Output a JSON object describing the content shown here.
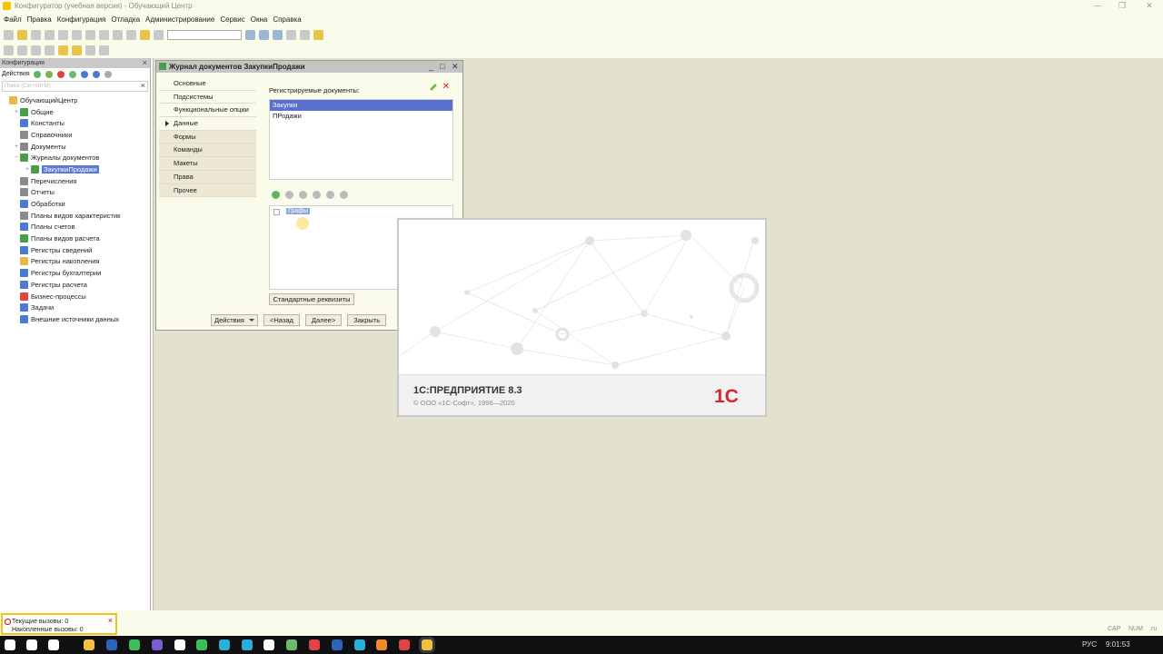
{
  "window": {
    "title": "Конфигуратор (учебная версия) - Обучающий Центр",
    "controls": [
      "—",
      "❐",
      "✕"
    ]
  },
  "menu": [
    "Файл",
    "Правка",
    "Конфигурация",
    "Отладка",
    "Администрирование",
    "Сервис",
    "Окна",
    "Справка"
  ],
  "config_panel": {
    "title": "Конфигурация",
    "actions_label": "Действия",
    "search_placeholder": "Поиск (Ctrl+Alt+M)",
    "tree": [
      {
        "label": "ОбучающийЦентр",
        "level": 0,
        "expander": "",
        "icon_color": "#e7b84a"
      },
      {
        "label": "Общие",
        "level": 1,
        "expander": "+",
        "icon_color": "#4c9c4c"
      },
      {
        "label": "Константы",
        "level": 1,
        "expander": "",
        "icon_color": "#4a7bd0"
      },
      {
        "label": "Справочники",
        "level": 1,
        "expander": "",
        "icon_color": "#8a8a8a"
      },
      {
        "label": "Документы",
        "level": 1,
        "expander": "+",
        "icon_color": "#8a8a8a"
      },
      {
        "label": "Журналы документов",
        "level": 1,
        "expander": "−",
        "icon_color": "#4c9c4c"
      },
      {
        "label": "ЗакупкиПродажи",
        "level": 2,
        "expander": "+",
        "icon_color": "#4c9c4c",
        "selected": true
      },
      {
        "label": "Перечисления",
        "level": 1,
        "expander": "",
        "icon_color": "#8a8a8a"
      },
      {
        "label": "Отчеты",
        "level": 1,
        "expander": "",
        "icon_color": "#8a8a8a"
      },
      {
        "label": "Обработки",
        "level": 1,
        "expander": "",
        "icon_color": "#4a7bd0"
      },
      {
        "label": "Планы видов характеристик",
        "level": 1,
        "expander": "",
        "icon_color": "#8a8a8a"
      },
      {
        "label": "Планы счетов",
        "level": 1,
        "expander": "",
        "icon_color": "#4a7bd0"
      },
      {
        "label": "Планы видов расчета",
        "level": 1,
        "expander": "",
        "icon_color": "#4c9c4c"
      },
      {
        "label": "Регистры сведений",
        "level": 1,
        "expander": "",
        "icon_color": "#4a7bd0"
      },
      {
        "label": "Регистры накопления",
        "level": 1,
        "expander": "",
        "icon_color": "#e7b84a"
      },
      {
        "label": "Регистры бухгалтерии",
        "level": 1,
        "expander": "",
        "icon_color": "#4a7bd0"
      },
      {
        "label": "Регистры расчета",
        "level": 1,
        "expander": "",
        "icon_color": "#4a7bd0"
      },
      {
        "label": "Бизнес-процессы",
        "level": 1,
        "expander": "",
        "icon_color": "#d44"
      },
      {
        "label": "Задачи",
        "level": 1,
        "expander": "",
        "icon_color": "#4a7bd0"
      },
      {
        "label": "Внешние источники данных",
        "level": 1,
        "expander": "",
        "icon_color": "#4a7bd0"
      }
    ]
  },
  "doc_window": {
    "title": "Журнал документов ЗакупкиПродажи",
    "tabs": [
      {
        "label": "Основные",
        "style": "light"
      },
      {
        "label": "Подсистемы",
        "style": "light"
      },
      {
        "label": "Функциональные опции",
        "style": "light"
      },
      {
        "label": "Данные",
        "style": "active"
      },
      {
        "label": "Формы",
        "style": "dark"
      },
      {
        "label": "Команды",
        "style": "dark"
      },
      {
        "label": "Макеты",
        "style": "dark"
      },
      {
        "label": "Права",
        "style": "dark"
      },
      {
        "label": "Прочее",
        "style": "dark"
      }
    ],
    "registered_label": "Регистрируемые документы:",
    "registered_docs": [
      {
        "label": "Закупки",
        "selected": true
      },
      {
        "label": "ПРодажи",
        "selected": false
      }
    ],
    "graph_node": "Графы",
    "std_attrs_button": "Стандартные реквизиты",
    "buttons": {
      "actions": "Действия",
      "back": "<Назад",
      "next": "Далее>",
      "close": "Закрыть"
    }
  },
  "splash": {
    "product": "1С:ПРЕДПРИЯТИЕ 8.3",
    "copyright": "© ООО «1С-Софт», 1996—2020",
    "logo_text": "1С"
  },
  "calls_panel": {
    "current": "Текущие вызовы: 0",
    "accumulated": "Накопленные вызовы: 0"
  },
  "status_indicators": [
    "CAP",
    "NUM",
    "ru"
  ],
  "tray": {
    "lang": "РУС",
    "time": "9:01:53"
  },
  "taskbar_icons": [
    {
      "name": "start-icon",
      "color": "#ffffff"
    },
    {
      "name": "search-icon",
      "color": "#ffffff"
    },
    {
      "name": "task-view-icon",
      "color": "#ffffff"
    },
    {
      "name": "explorer-icon",
      "color": "#f0c040"
    },
    {
      "name": "photoshop-icon",
      "color": "#2a63b8"
    },
    {
      "name": "whatsapp-icon",
      "color": "#3bbf5a"
    },
    {
      "name": "viber-icon",
      "color": "#7b5bd0"
    },
    {
      "name": "yandex-icon",
      "color": "#ffffff"
    },
    {
      "name": "chrome-icon",
      "color": "#3bbf5a"
    },
    {
      "name": "edge-icon",
      "color": "#2ab0d8"
    },
    {
      "name": "telegram-icon",
      "color": "#2ab0d8"
    },
    {
      "name": "opera-icon",
      "color": "#ffffff"
    },
    {
      "name": "notepad-icon",
      "color": "#6fb86f"
    },
    {
      "name": "media-icon",
      "color": "#d44"
    },
    {
      "name": "word-icon",
      "color": "#2a63b8"
    },
    {
      "name": "files-icon",
      "color": "#2ab0d8"
    },
    {
      "name": "paint-icon",
      "color": "#f08a30"
    },
    {
      "name": "app-icon",
      "color": "#d44"
    },
    {
      "name": "1c-icon",
      "color": "#f0c040"
    }
  ]
}
